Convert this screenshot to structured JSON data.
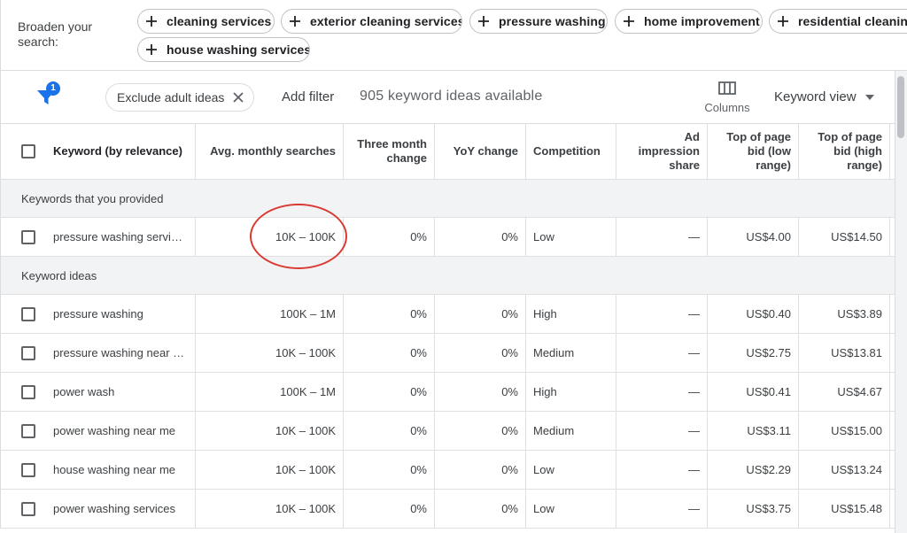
{
  "broaden": {
    "label": "Broaden your search:",
    "chips": [
      "cleaning services",
      "exterior cleaning services",
      "pressure washing",
      "home improvement",
      "residential cleaning",
      "house washing services"
    ]
  },
  "toolbar": {
    "filter_badge": "1",
    "exclude_chip": "Exclude adult ideas",
    "add_filter": "Add filter",
    "ideas_count": "905 keyword ideas available",
    "columns_label": "Columns",
    "view_label": "Keyword view"
  },
  "table": {
    "headers": [
      "Keyword (by relevance)",
      "Avg. monthly searches",
      "Three month change",
      "YoY change",
      "Competition",
      "Ad impression share",
      "Top of page bid (low range)",
      "Top of page bid (high range)"
    ],
    "provided_group_label": "Keywords that you provided",
    "provided_rows": [
      {
        "keyword": "pressure washing servic…",
        "searches": "10K – 100K",
        "three_month": "0%",
        "yoy": "0%",
        "competition": "Low",
        "impression_share": "—",
        "bid_low": "US$4.00",
        "bid_high": "US$14.50"
      }
    ],
    "ideas_group_label": "Keyword ideas",
    "idea_rows": [
      {
        "keyword": "pressure washing",
        "searches": "100K – 1M",
        "three_month": "0%",
        "yoy": "0%",
        "competition": "High",
        "impression_share": "—",
        "bid_low": "US$0.40",
        "bid_high": "US$3.89"
      },
      {
        "keyword": "pressure washing near …",
        "searches": "10K – 100K",
        "three_month": "0%",
        "yoy": "0%",
        "competition": "Medium",
        "impression_share": "—",
        "bid_low": "US$2.75",
        "bid_high": "US$13.81"
      },
      {
        "keyword": "power wash",
        "searches": "100K – 1M",
        "three_month": "0%",
        "yoy": "0%",
        "competition": "High",
        "impression_share": "—",
        "bid_low": "US$0.41",
        "bid_high": "US$4.67"
      },
      {
        "keyword": "power washing near me",
        "searches": "10K – 100K",
        "three_month": "0%",
        "yoy": "0%",
        "competition": "Medium",
        "impression_share": "—",
        "bid_low": "US$3.11",
        "bid_high": "US$15.00"
      },
      {
        "keyword": "house washing near me",
        "searches": "10K – 100K",
        "three_month": "0%",
        "yoy": "0%",
        "competition": "Low",
        "impression_share": "—",
        "bid_low": "US$2.29",
        "bid_high": "US$13.24"
      },
      {
        "keyword": "power washing services",
        "searches": "10K – 100K",
        "three_month": "0%",
        "yoy": "0%",
        "competition": "Low",
        "impression_share": "—",
        "bid_low": "US$3.75",
        "bid_high": "US$15.48"
      }
    ]
  },
  "colors": {
    "accent": "#1a73e8",
    "annotation": "#d93a32",
    "group_background": "#f1f3f4"
  }
}
